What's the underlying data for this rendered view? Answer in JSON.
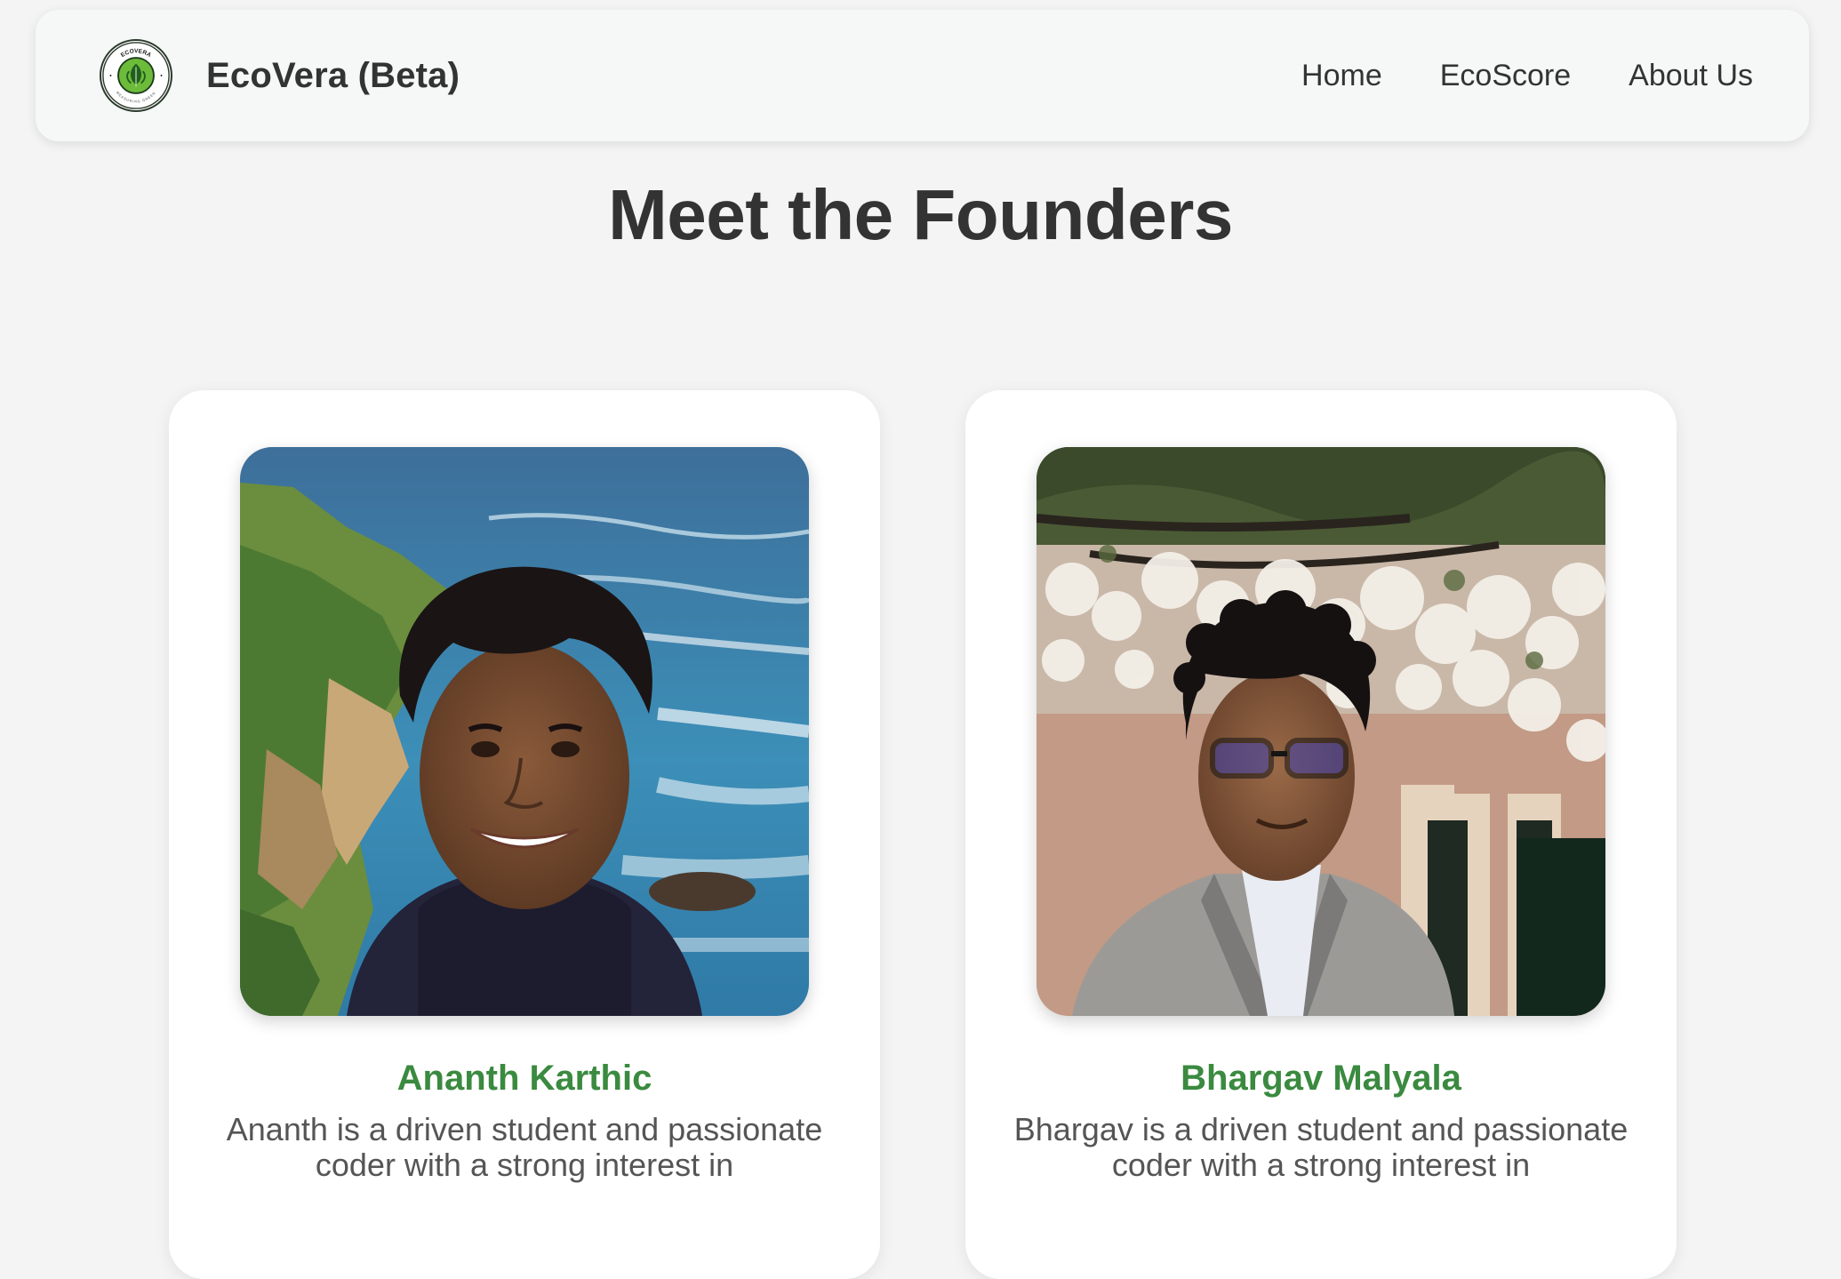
{
  "header": {
    "brand_title": "EcoVera (Beta)",
    "logo_text_top": "ECOVERA",
    "logo_text_bottom": "MEASURING GREEN",
    "nav": [
      {
        "label": "Home"
      },
      {
        "label": "EcoScore"
      },
      {
        "label": "About Us"
      }
    ]
  },
  "main": {
    "title": "Meet the Founders",
    "founders": [
      {
        "name": "Ananth Karthic",
        "bio": "Ananth is a driven student and passionate coder with a strong interest in"
      },
      {
        "name": "Bhargav Malyala",
        "bio": "Bhargav is a driven student and passionate coder with a strong interest in"
      }
    ]
  },
  "colors": {
    "page_background": "#f4f4f4",
    "navbar_background": "#f6f8f7",
    "text_dark": "#333333",
    "founder_name_green": "#3a8a3f",
    "bio_gray": "#555555",
    "card_background": "#ffffff"
  }
}
